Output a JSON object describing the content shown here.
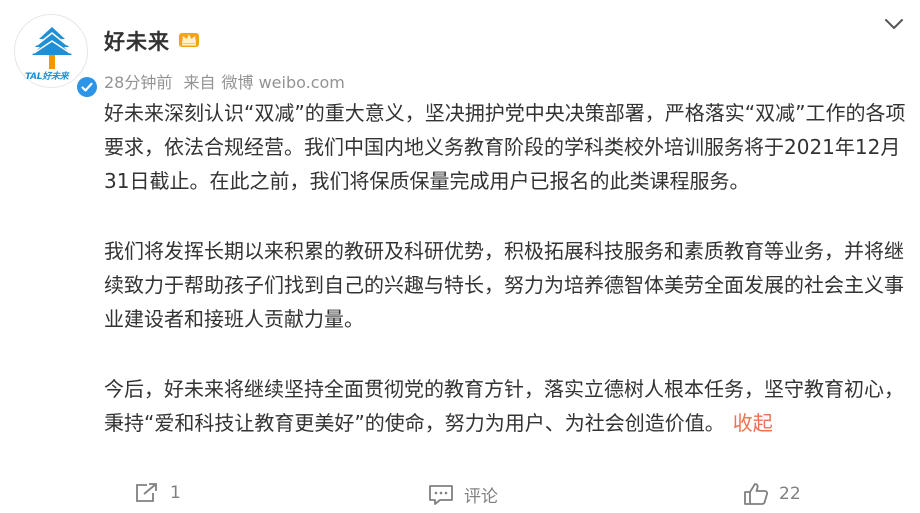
{
  "author": {
    "name": "好未来",
    "avatar_text": "TAL好未来",
    "verified": true
  },
  "meta": {
    "time": "28分钟前",
    "source_prefix": "来自",
    "source": "微博 weibo.com"
  },
  "content": {
    "paragraphs": [
      "好未来深刻认识“双减”的重大意义，坚决拥护党中央决策部署，严格落实“双减”工作的各项要求，依法合规经营。我们中国内地义务教育阶段的学科类校外培训服务将于2021年12月31日截止。在此之前，我们将保质保量完成用户已报名的此类课程服务。",
      "我们将发挥长期以来积累的教研及科研优势，积极拓展科技服务和素质教育等业务，并将继续致力于帮助孩子们找到自己的兴趣与特长，努力为培养德智体美劳全面发展的社会主义事业建设者和接班人贡献力量。",
      "今后，好未来将继续坚持全面贯彻党的教育方针，落实立德树人根本任务，坚守教育初心，秉持“爱和科技让教育更美好”的使命，努力为用户、为社会创造价值。"
    ],
    "collapse_label": "收起"
  },
  "actions": {
    "repost": "1",
    "comment": "评论",
    "like": "22"
  },
  "icons": [
    "crown-icon",
    "verified-icon",
    "chevron-down-icon",
    "repost-icon",
    "comment-icon",
    "like-icon"
  ],
  "colors": {
    "accent": "#eb7350",
    "brand_blue": "#1f8fd6",
    "brand_orange": "#f39800",
    "muted": "#939393"
  }
}
